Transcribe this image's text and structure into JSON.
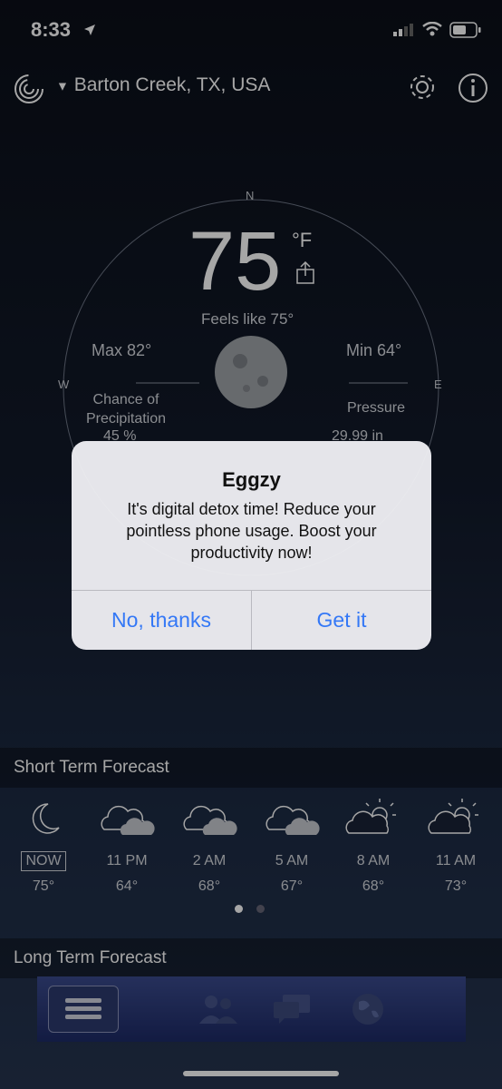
{
  "status": {
    "time": "8:33"
  },
  "header": {
    "location": "Barton Creek, TX, USA"
  },
  "weather": {
    "compass_n": "N",
    "compass_w": "W",
    "compass_e": "E",
    "temp": "75",
    "unit": "°F",
    "feels_like": "Feels like 75°",
    "max": "Max 82°",
    "min": "Min 64°",
    "chance_label": "Chance of Precipitation",
    "chance_value": "45 %",
    "pressure_label": "Pressure",
    "pressure_value": "29.99 in"
  },
  "dialog": {
    "title": "Eggzy",
    "message": "It's digital detox time! Reduce your pointless phone usage. Boost your productivity now!",
    "cancel": "No, thanks",
    "confirm": "Get it"
  },
  "short_term": {
    "label": "Short Term Forecast",
    "items": [
      {
        "time": "NOW",
        "temp": "75°",
        "icon": "moon-icon"
      },
      {
        "time": "11 PM",
        "temp": "64°",
        "icon": "cloudy-icon"
      },
      {
        "time": "2 AM",
        "temp": "68°",
        "icon": "cloudy-icon"
      },
      {
        "time": "5 AM",
        "temp": "67°",
        "icon": "cloudy-icon"
      },
      {
        "time": "8 AM",
        "temp": "68°",
        "icon": "partly-sunny-icon"
      },
      {
        "time": "11 AM",
        "temp": "73°",
        "icon": "partly-sunny-icon"
      }
    ]
  },
  "long_term": {
    "label": "Long Term Forecast"
  }
}
